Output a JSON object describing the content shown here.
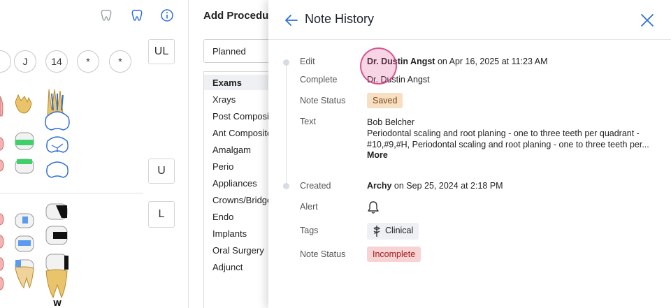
{
  "chart": {
    "tooth_circles": [
      "",
      "J",
      "14",
      "*",
      "*"
    ],
    "arch_buttons": [
      "UL",
      "U",
      "L"
    ],
    "tooth_marker": "W"
  },
  "procedures": {
    "title": "Add Procedure",
    "status_select": "Planned",
    "categories": [
      "Exams",
      "Xrays",
      "Post Composites",
      "Ant Composites",
      "Amalgam",
      "Perio",
      "Appliances",
      "Crowns/Bridges",
      "Endo",
      "Implants",
      "Oral Surgery",
      "Adjunct"
    ]
  },
  "note_history": {
    "title": "Note History",
    "entries": [
      {
        "action_label": "Edit",
        "author": "Dr. Dustin Angst",
        "timestamp": "on Apr 16, 2025 at 11:23 AM",
        "complete_label": "Complete",
        "complete_value": "Dr. Dustin Angst",
        "status_label": "Note Status",
        "status_value": "Saved",
        "text_label": "Text",
        "text_lines": [
          "Bob Belcher",
          "Periodontal scaling and root planing - one to three teeth per quadrant -",
          "#10,#9,#H, Periodontal scaling and root planing - one to three teeth per..."
        ],
        "more_label": "More"
      },
      {
        "action_label": "Created",
        "author": "Archy",
        "timestamp": "on Sep 25, 2024 at 2:18 PM",
        "alert_label": "Alert",
        "tags_label": "Tags",
        "tag_value": "Clinical",
        "status_label": "Note Status",
        "status_value": "Incomplete"
      }
    ]
  },
  "colors": {
    "accent": "#2f6fd6",
    "saved_bg": "#f7dfc3",
    "incomplete_bg": "#f8d3d3",
    "cursor": "#de5896"
  },
  "icons": {
    "back": "arrow-left-icon",
    "close": "close-icon",
    "alert": "bell-icon",
    "tag": "caduceus-icon",
    "info": "info-icon",
    "tooth": "tooth-icon"
  }
}
